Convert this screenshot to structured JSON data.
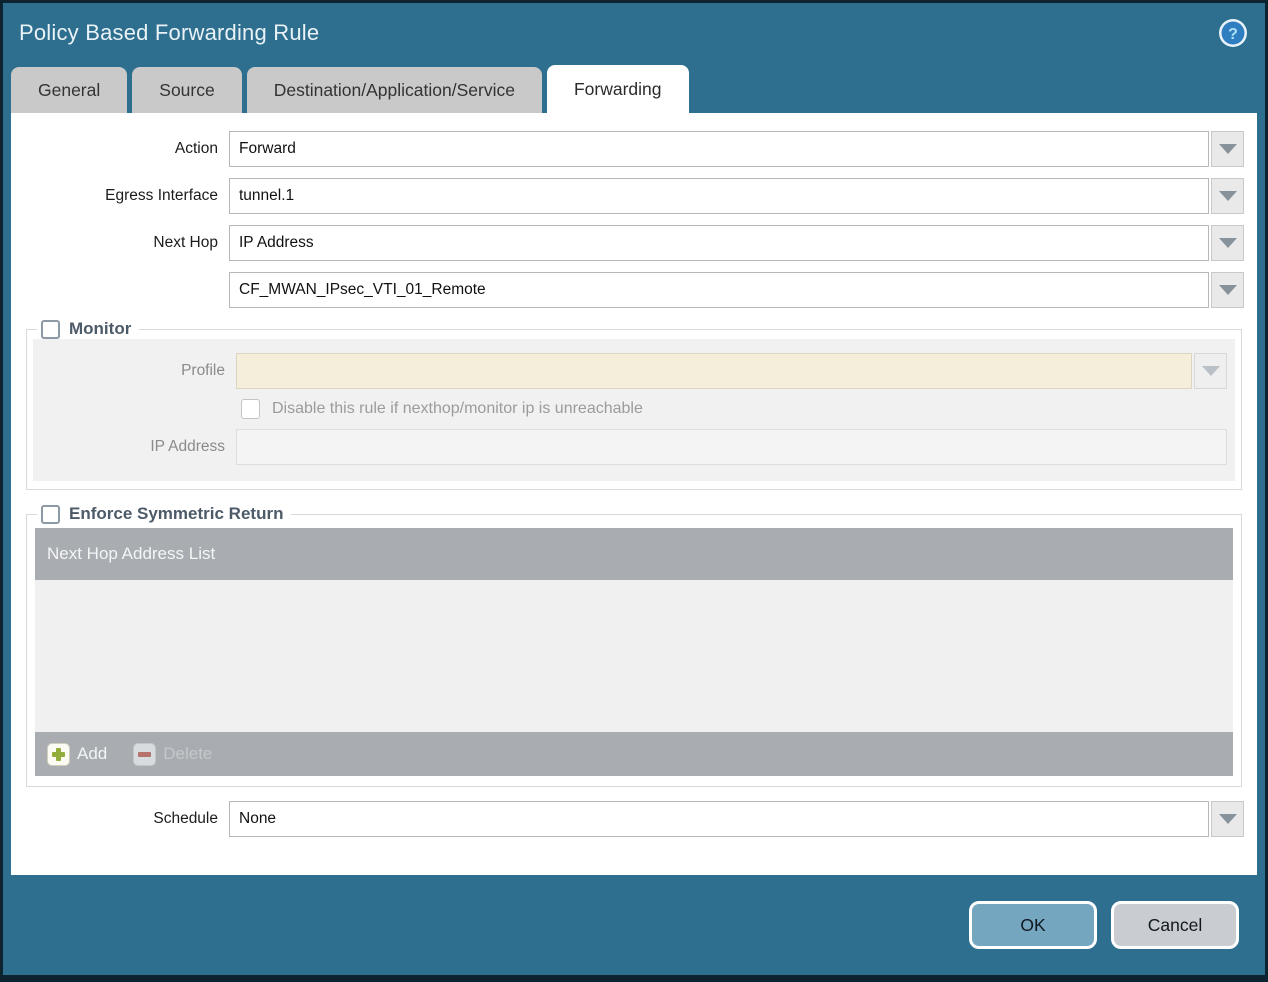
{
  "window": {
    "title": "Policy Based Forwarding Rule"
  },
  "tabs": [
    {
      "label": "General"
    },
    {
      "label": "Source"
    },
    {
      "label": "Destination/Application/Service"
    },
    {
      "label": "Forwarding"
    }
  ],
  "form": {
    "action": {
      "label": "Action",
      "value": "Forward"
    },
    "egress_interface": {
      "label": "Egress Interface",
      "value": "tunnel.1"
    },
    "next_hop": {
      "label": "Next Hop",
      "value": "IP Address"
    },
    "next_hop_address": {
      "value": "CF_MWAN_IPsec_VTI_01_Remote"
    },
    "schedule": {
      "label": "Schedule",
      "value": "None"
    }
  },
  "monitor": {
    "legend": "Monitor",
    "checked": false,
    "profile": {
      "label": "Profile",
      "value": ""
    },
    "disable_rule": {
      "label": "Disable this rule if nexthop/monitor ip is unreachable",
      "checked": false
    },
    "ip_address": {
      "label": "IP Address",
      "value": ""
    }
  },
  "enforce_symmetric_return": {
    "legend": "Enforce Symmetric Return",
    "checked": false,
    "table": {
      "header": "Next Hop Address List",
      "rows": []
    },
    "buttons": {
      "add": "Add",
      "delete": "Delete"
    }
  },
  "dialog_buttons": {
    "ok": "OK",
    "cancel": "Cancel"
  },
  "icons": {
    "help": "help-icon",
    "dropdown": "chevron-down-icon",
    "add": "plus-icon",
    "delete": "minus-icon"
  },
  "colors": {
    "titlebar_teal": "#2e6e8e",
    "border_dark": "#0d2330",
    "tab_inactive": "#c9c9c9",
    "legend_text": "#4d5a68",
    "table_header_gray": "#a9adb1",
    "profile_field_cream": "#f5eeda",
    "ok_button_blue": "#74a6bf",
    "cancel_button_gray": "#c9cdd1",
    "add_plus_green": "#93ad3c",
    "delete_minus_red": "#b5736b"
  }
}
